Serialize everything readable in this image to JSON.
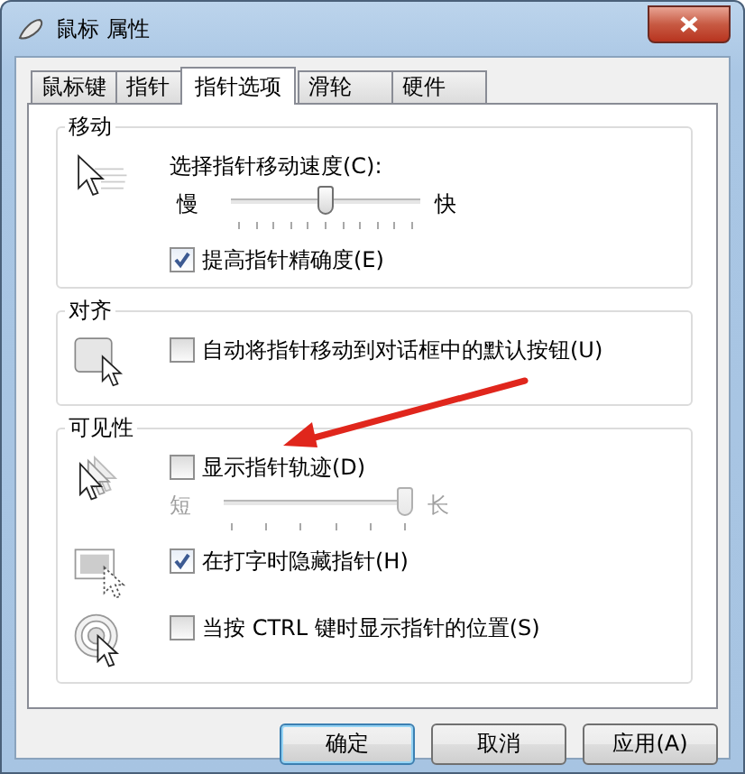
{
  "window": {
    "title": "鼠标 属性"
  },
  "tabs": [
    {
      "label": "鼠标键",
      "selected": false
    },
    {
      "label": "指针",
      "selected": false
    },
    {
      "label": "指针选项",
      "selected": true
    },
    {
      "label": "滑轮",
      "selected": false
    },
    {
      "label": "硬件",
      "selected": false
    }
  ],
  "groups": [
    {
      "title": "移动",
      "blocks": [
        {
          "rows": [
            {
              "kind": "label",
              "text": "选择指针移动速度(C):"
            },
            {
              "kind": "slider",
              "min_label": "慢",
              "max_label": "快",
              "level": 0.5,
              "disabled": false
            },
            {
              "kind": "checkbox",
              "label": "提高指针精确度(E)",
              "checked": true
            }
          ]
        }
      ]
    },
    {
      "title": "对齐",
      "blocks": [
        {
          "rows": [
            {
              "kind": "checkbox",
              "label": "自动将指针移动到对话框中的默认按钮(U)",
              "checked": false
            }
          ]
        }
      ]
    },
    {
      "title": "可见性",
      "blocks": [
        {
          "rows": [
            {
              "kind": "checkbox",
              "label": "显示指针轨迹(D)",
              "checked": false
            },
            {
              "kind": "slider",
              "min_label": "短",
              "max_label": "长",
              "level": 1,
              "disabled": true
            }
          ]
        },
        {
          "rows": [
            {
              "kind": "checkbox",
              "label": "在打字时隐藏指针(H)",
              "checked": true
            }
          ]
        },
        {
          "rows": [
            {
              "kind": "checkbox",
              "label": "当按 CTRL 键时显示指针的位置(S)",
              "checked": false
            }
          ]
        }
      ]
    }
  ],
  "buttons": [
    {
      "label": "确定",
      "default": true
    },
    {
      "label": "取消",
      "default": false
    },
    {
      "label": "应用(A)",
      "default": false
    }
  ]
}
